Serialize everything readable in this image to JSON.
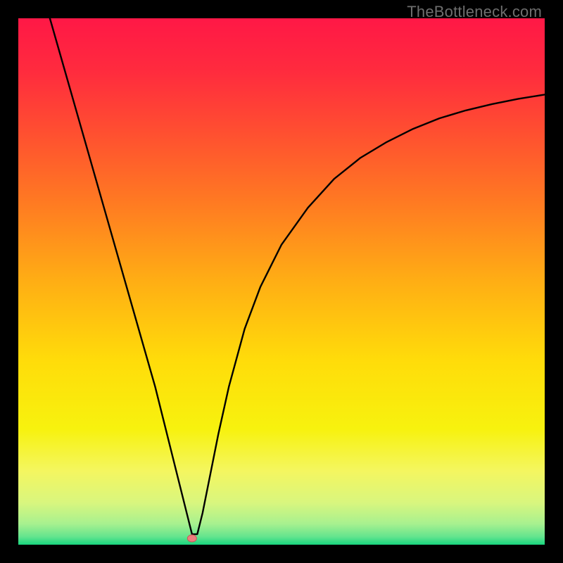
{
  "watermark": "TheBottleneck.com",
  "colors": {
    "gradient_stops": [
      {
        "offset": 0.0,
        "color": "#ff1846"
      },
      {
        "offset": 0.1,
        "color": "#ff2b3e"
      },
      {
        "offset": 0.22,
        "color": "#ff5030"
      },
      {
        "offset": 0.35,
        "color": "#ff7a22"
      },
      {
        "offset": 0.5,
        "color": "#ffae14"
      },
      {
        "offset": 0.65,
        "color": "#ffdc0a"
      },
      {
        "offset": 0.78,
        "color": "#f7f20e"
      },
      {
        "offset": 0.86,
        "color": "#f4f660"
      },
      {
        "offset": 0.92,
        "color": "#d9f67e"
      },
      {
        "offset": 0.96,
        "color": "#a8f18f"
      },
      {
        "offset": 0.985,
        "color": "#63e48e"
      },
      {
        "offset": 1.0,
        "color": "#18d67f"
      }
    ],
    "curve": "#000000",
    "marker_fill": "#ed7e7e",
    "marker_stroke": "#c95858",
    "background_outer": "#000000"
  },
  "chart_data": {
    "type": "line",
    "title": "",
    "xlabel": "",
    "ylabel": "",
    "xlim": [
      0,
      100
    ],
    "ylim": [
      0,
      100
    ],
    "marker": {
      "x": 33,
      "y": 1.2
    },
    "series": [
      {
        "name": "bottleneck-curve",
        "x": [
          6,
          8,
          10,
          12,
          14,
          16,
          18,
          20,
          22,
          24,
          26,
          28,
          29,
          30,
          31,
          32,
          33,
          34,
          35,
          36,
          38,
          40,
          43,
          46,
          50,
          55,
          60,
          65,
          70,
          75,
          80,
          85,
          90,
          95,
          100
        ],
        "y": [
          100,
          93,
          86,
          79,
          72,
          65,
          58,
          51,
          44,
          37,
          30,
          22,
          18,
          14,
          10,
          6,
          2,
          2,
          6,
          11,
          21,
          30,
          41,
          49,
          57,
          64,
          69.5,
          73.5,
          76.5,
          79,
          81,
          82.5,
          83.7,
          84.7,
          85.5
        ]
      }
    ]
  }
}
